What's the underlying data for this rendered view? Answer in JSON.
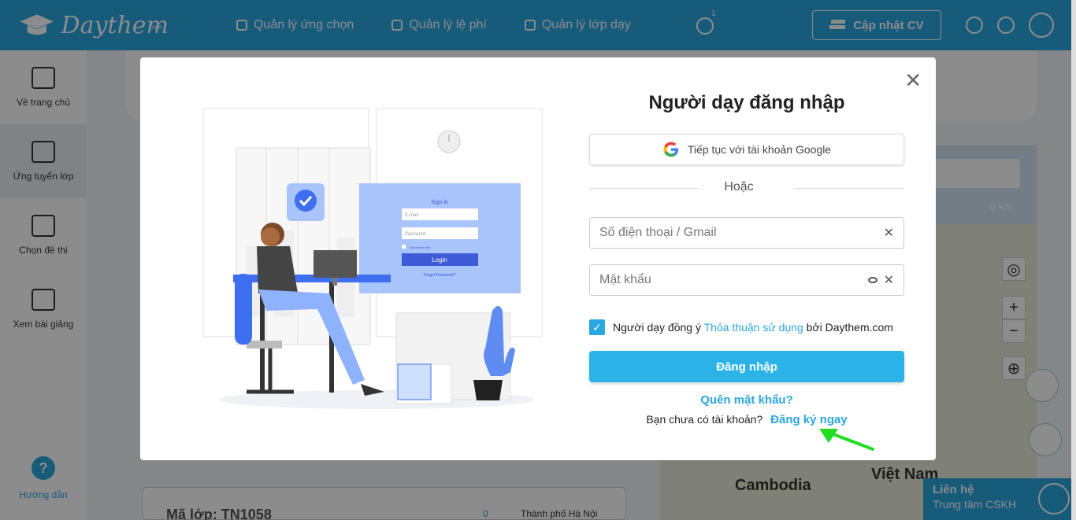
{
  "header": {
    "logo_text": "Daythem",
    "logo_sub": ".com",
    "nav": [
      "Quản lý ứng chọn",
      "Quản lý lệ phí",
      "Quản lý lớp dạy"
    ],
    "chat_badge": "1",
    "cv_button": "Cập nhật CV"
  },
  "sidebar": {
    "items": [
      "Về trang chủ",
      "Ứng tuyển lớp",
      "Chọn đề thi",
      "Xem bài giảng"
    ],
    "help": "Hướng dẫn",
    "help_symbol": "?"
  },
  "background": {
    "km": "0 km",
    "map_labels": [
      "Cambodia",
      "Việt Nam"
    ],
    "list_title": "Mã lớp: TN1058",
    "list_count": "0",
    "list_location": "Thành phố Hà Nội",
    "zoom_in": "+",
    "zoom_out": "−"
  },
  "contact": {
    "title": "Liên hệ",
    "subtitle": "Trung tâm CSKH"
  },
  "modal": {
    "close": "✕",
    "title": "Người dạy đăng nhập",
    "google_button": "Tiếp tục với tài khoản Google",
    "divider": "Hoặc",
    "phone_placeholder": "Số điện thoại / Gmail",
    "password_placeholder": "Mật khẩu",
    "agree_prefix": "Người dạy đồng ý",
    "agree_link": "Thỏa thuận sử dụng",
    "agree_suffix": "bởi Daythem.com",
    "login_button": "Đăng nhập",
    "forgot": "Quên mật khẩu?",
    "no_account": "Bạn chưa có tài khoản?",
    "signup_link": "Đăng ký ngay",
    "illus_signin": "Sign in",
    "illus_email": "E-mail",
    "illus_password": "Password",
    "illus_remember": "Remember me",
    "illus_login": "Login",
    "illus_forgot": "Forgot Password?"
  },
  "colors": {
    "primary": "#2aa6e0",
    "button": "#2bb3e8",
    "annotation_arrow": "#22dd22"
  }
}
